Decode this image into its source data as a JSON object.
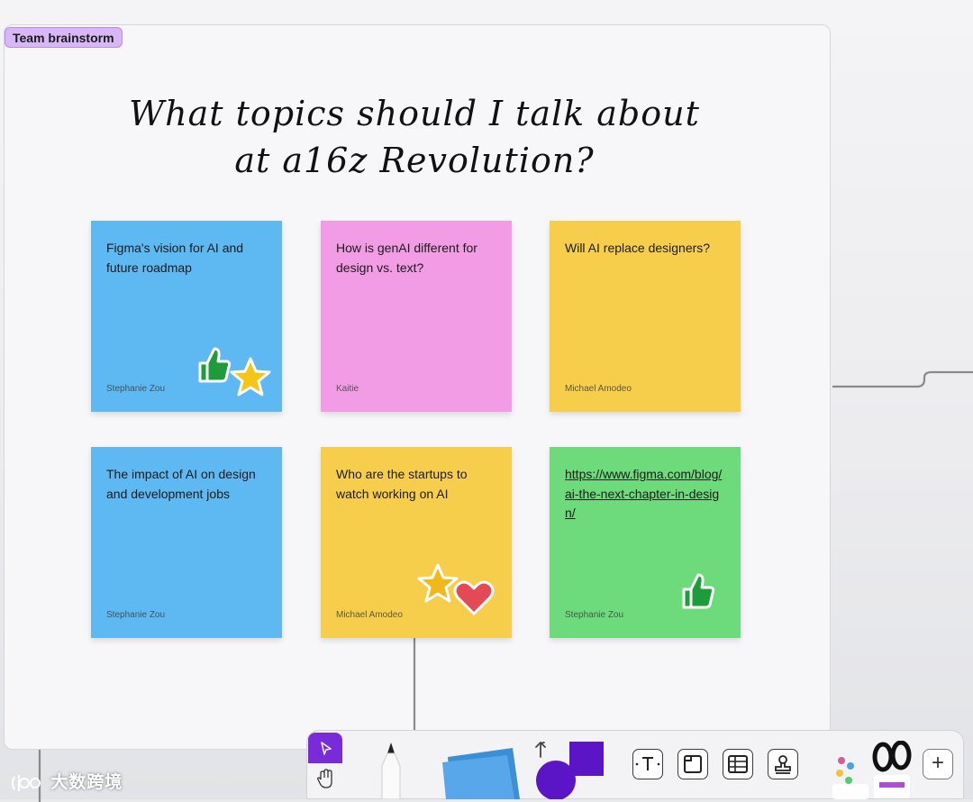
{
  "section": {
    "label": "Team brainstorm"
  },
  "headline": {
    "line1": "What topics should I talk about",
    "line2": "at a16z Revolution?"
  },
  "notes": [
    {
      "text": "Figma's vision for AI and future roadmap",
      "author": "Stephanie Zou",
      "color": "#5eb8f2",
      "stickers": [
        "thumbs-up",
        "star"
      ]
    },
    {
      "text": "How is genAI different for design vs. text?",
      "author": "Kaitie",
      "color": "#f29ce6",
      "stickers": []
    },
    {
      "text": "Will AI replace designers?",
      "author": "Michael Amodeo",
      "color": "#f6ce4c",
      "stickers": []
    },
    {
      "text": "The impact of AI on design and development jobs",
      "author": "Stephanie Zou",
      "color": "#5eb8f2",
      "stickers": []
    },
    {
      "text": "Who are the startups to watch working on AI",
      "author": "Michael Amodeo",
      "color": "#f6ce4c",
      "stickers": [
        "star",
        "heart"
      ]
    },
    {
      "text": "https://www.figma.com/blog/ai-the-next-chapter-in-design/",
      "author": "Stephanie Zou",
      "color": "#6ddb7c",
      "stickers": [
        "thumbs-up"
      ]
    }
  ],
  "toolbar": {
    "tools": [
      "move",
      "hand",
      "pen",
      "sticky-note",
      "shapes",
      "text",
      "section",
      "table",
      "stamp",
      "stickers",
      "more"
    ],
    "accent": "#7a2bd9",
    "plus_label": "+"
  },
  "watermark": {
    "text": "大数跨境"
  }
}
